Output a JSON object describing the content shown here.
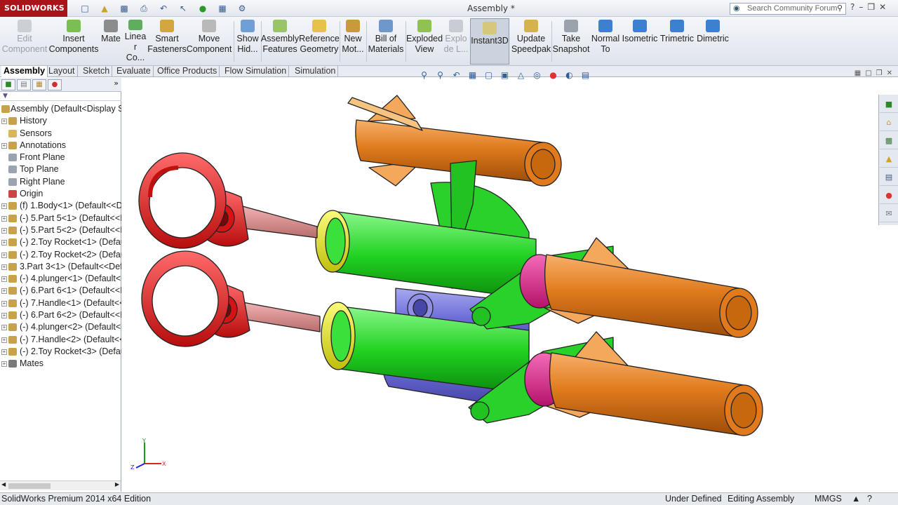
{
  "app": {
    "logo_text": "SOLIDWORKS",
    "window_title": "Assembly *"
  },
  "search": {
    "placeholder": "Search Community Forum"
  },
  "ribbon": {
    "edit_component": "Edit Component",
    "insert_components": "Insert Components",
    "mate": "Mate",
    "linear_pattern": "Linea r Co...",
    "smart_fasteners": "Smart Fasteners",
    "move_component": "Move Component",
    "show_hidden": "Show Hid...",
    "assembly_features": "Assembly Features",
    "reference_geometry": "Reference Geometry",
    "new_motion": "New Mot...",
    "bill_of_materials": "Bill of Materials",
    "exploded_view": "Exploded View",
    "explode_line": "Explo de L...",
    "instant3d": "Instant3D",
    "update_speedpak": "Update Speedpak",
    "take_snapshot": "Take Snapshot",
    "normal_to": "Normal To",
    "isometric": "Isometric",
    "trimetric": "Trimetric",
    "dimetric": "Dimetric"
  },
  "tabs": [
    "Assembly",
    "Layout",
    "Sketch",
    "Evaluate",
    "Office Products",
    "Flow Simulation",
    "Simulation"
  ],
  "tree": {
    "root": "Assembly  (Default<Display S",
    "items": [
      {
        "label": "History",
        "icon": "history-icon",
        "color": "#c8a24a",
        "expand": "+"
      },
      {
        "label": "Sensors",
        "icon": "sensors-icon",
        "color": "#d9b65a",
        "expand": ""
      },
      {
        "label": "Annotations",
        "icon": "annotations-icon",
        "color": "#c8a24a",
        "expand": "+"
      },
      {
        "label": "Front Plane",
        "icon": "plane-icon",
        "color": "#9aa3b0",
        "expand": ""
      },
      {
        "label": "Top Plane",
        "icon": "plane-icon",
        "color": "#9aa3b0",
        "expand": ""
      },
      {
        "label": "Right Plane",
        "icon": "plane-icon",
        "color": "#9aa3b0",
        "expand": ""
      },
      {
        "label": "Origin",
        "icon": "origin-icon",
        "color": "#c44",
        "expand": ""
      },
      {
        "label": "(f) 1.Body<1> (Default<<De",
        "icon": "part-icon",
        "color": "#c8a24a",
        "expand": "+"
      },
      {
        "label": "(-) 5.Part 5<1> (Default<<D",
        "icon": "part-icon",
        "color": "#c8a24a",
        "expand": "+"
      },
      {
        "label": "(-) 5.Part 5<2> (Default<<D",
        "icon": "part-icon",
        "color": "#c8a24a",
        "expand": "+"
      },
      {
        "label": "(-) 2.Toy Rocket<1> (Defau",
        "icon": "part-icon",
        "color": "#c8a24a",
        "expand": "+"
      },
      {
        "label": "(-) 2.Toy Rocket<2> (Defau",
        "icon": "part-icon",
        "color": "#c8a24a",
        "expand": "+"
      },
      {
        "label": "3.Part 3<1> (Default<<Defa",
        "icon": "part-icon",
        "color": "#c8a24a",
        "expand": "+"
      },
      {
        "label": "(-) 4.plunger<1> (Default<<",
        "icon": "part-icon",
        "color": "#c8a24a",
        "expand": "+"
      },
      {
        "label": "(-) 6.Part 6<1> (Default<<D",
        "icon": "part-icon",
        "color": "#c8a24a",
        "expand": "+"
      },
      {
        "label": "(-) 7.Handle<1> (Default<<",
        "icon": "part-icon",
        "color": "#c8a24a",
        "expand": "+"
      },
      {
        "label": "(-) 6.Part 6<2> (Default<<D",
        "icon": "part-icon",
        "color": "#c8a24a",
        "expand": "+"
      },
      {
        "label": "(-) 4.plunger<2> (Default<<",
        "icon": "part-icon",
        "color": "#c8a24a",
        "expand": "+"
      },
      {
        "label": "(-) 7.Handle<2> (Default<<",
        "icon": "part-icon",
        "color": "#c8a24a",
        "expand": "+"
      },
      {
        "label": "(-) 2.Toy Rocket<3> (Defau",
        "icon": "part-icon",
        "color": "#c8a24a",
        "expand": "+"
      },
      {
        "label": "Mates",
        "icon": "mates-icon",
        "color": "#7a7a7a",
        "expand": "+"
      }
    ]
  },
  "triad": {
    "x": "X",
    "y": "Y",
    "z": "Z"
  },
  "status": {
    "edition": "SolidWorks Premium 2014 x64 Edition",
    "state": "Under Defined",
    "mode": "Editing Assembly",
    "units": "MMGS"
  },
  "colors": {
    "brand": "#a9141b",
    "rocket": "#e07a1c",
    "cylinder": "#2bd12b",
    "ring": "#e8e81c",
    "grip": "#e61b1b",
    "base": "#6a6ad8",
    "collar": "#e81f8c"
  }
}
